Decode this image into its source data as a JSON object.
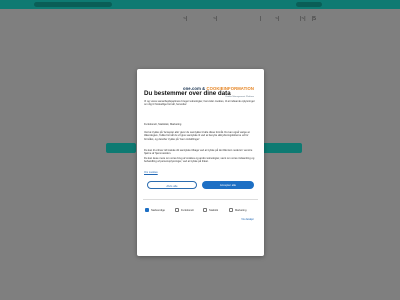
{
  "nav": {
    "items": [
      "~|",
      "~|",
      "|",
      "~|",
      "|~|",
      "|5"
    ]
  },
  "modal": {
    "logo_brand": "one.com",
    "logo_amp": "&",
    "logo_brand2": "COOKIEINFORMATION",
    "logo_tagline": "Cookie Management Platform",
    "title": "Du bestemmer over dine data",
    "intro": "Vi og vores samarbejdspartnere bruger teknologier, herunder cookies, til at indsamle oplysninger om dig til forskellige formål, herunder:",
    "purposes": "Funktionelt, Statistisk, Marketing",
    "body1": "Ved at trykke på 'Accepter alle' giver du samtykke til alle disse formål. Du kan også vælge at tilkendegive, hvilke formål du vil give samtykke til ved at benytte afkrydsningsfelterne ud for formålet, og derefter trykke på 'Gem indstillinger'.",
    "body2": "Du kan til enhver tid trække dit samtykke tilbage ved at trykke på det lille ikon nederst i venstre hjørne af hjemmesiden.",
    "body3": "Du kan læse mere om vores brug af cookies og andre teknologier, samt om vores indsamling og behandling af personoplysninger, ved at trykke på linket.",
    "link": "Om cookies",
    "reject_label": "Afvis alle",
    "accept_label": "Accepter alle",
    "toggles": [
      {
        "label": "Nødvendige",
        "checked": true
      },
      {
        "label": "Funktionelt",
        "checked": false
      },
      {
        "label": "Statistik",
        "checked": false
      },
      {
        "label": "Marketing",
        "checked": false
      }
    ],
    "details_link": "Vis detaljer"
  }
}
